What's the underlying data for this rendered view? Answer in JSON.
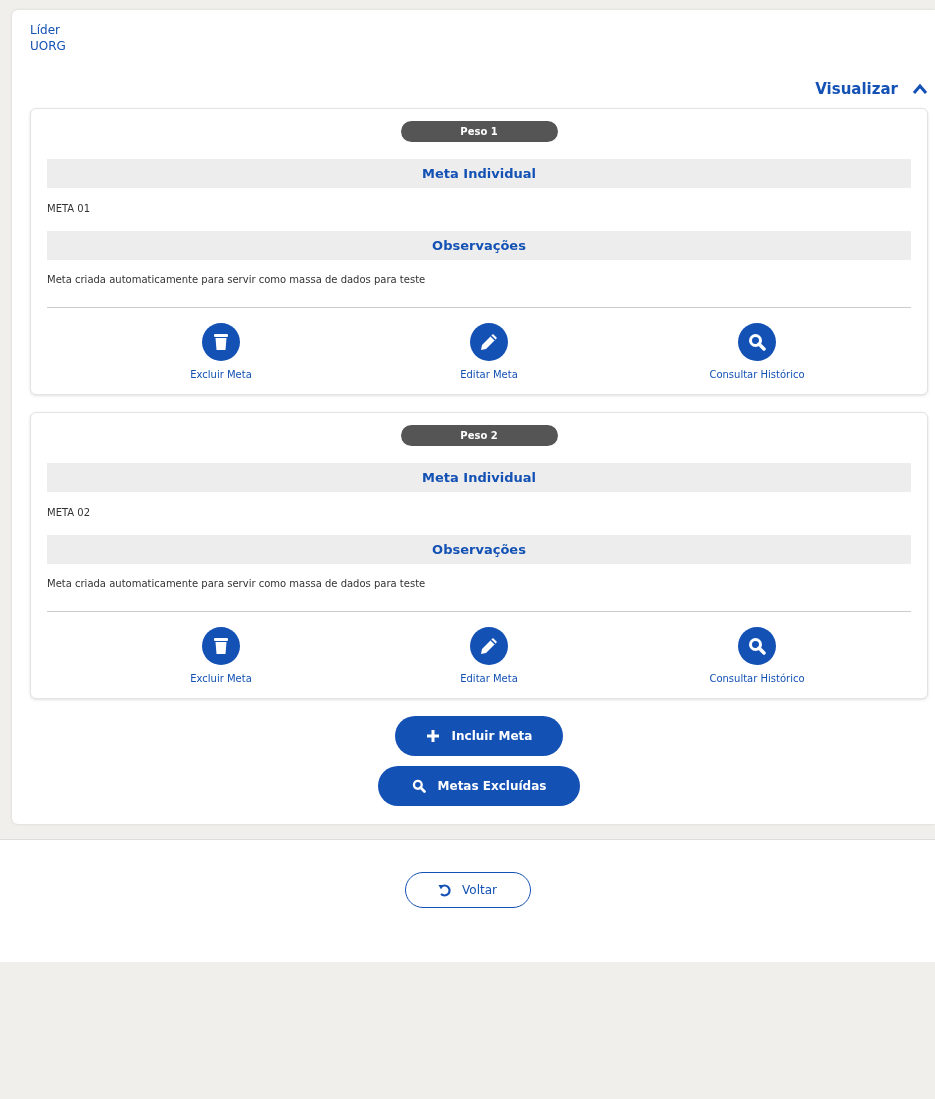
{
  "header": {
    "lines": [
      "Líder",
      "UORG"
    ]
  },
  "toggle": {
    "label": "Visualizar",
    "expanded": true
  },
  "goals": [
    {
      "weight": "Peso 1",
      "goal_heading": "Meta Individual",
      "goal": "META 01",
      "notes_heading": "Observações",
      "notes": "Meta criada automaticamente para servir como massa de dados para teste",
      "actions": [
        {
          "kind": "delete",
          "label": "Excluir Meta"
        },
        {
          "kind": "edit",
          "label": "Editar Meta"
        },
        {
          "kind": "history",
          "label": "Consultar Histórico"
        }
      ]
    },
    {
      "weight": "Peso 2",
      "goal_heading": "Meta Individual",
      "goal": "META 02",
      "notes_heading": "Observações",
      "notes": "Meta criada automaticamente para servir como massa de dados para teste",
      "actions": [
        {
          "kind": "delete",
          "label": "Excluir Meta"
        },
        {
          "kind": "edit",
          "label": "Editar Meta"
        },
        {
          "kind": "history",
          "label": "Consultar Histórico"
        }
      ]
    }
  ],
  "buttons": [
    {
      "kind": "add",
      "label": "Incluir Meta"
    },
    {
      "kind": "search",
      "label": "Metas Excluídas"
    }
  ],
  "back_button": {
    "label": "Voltar"
  }
}
